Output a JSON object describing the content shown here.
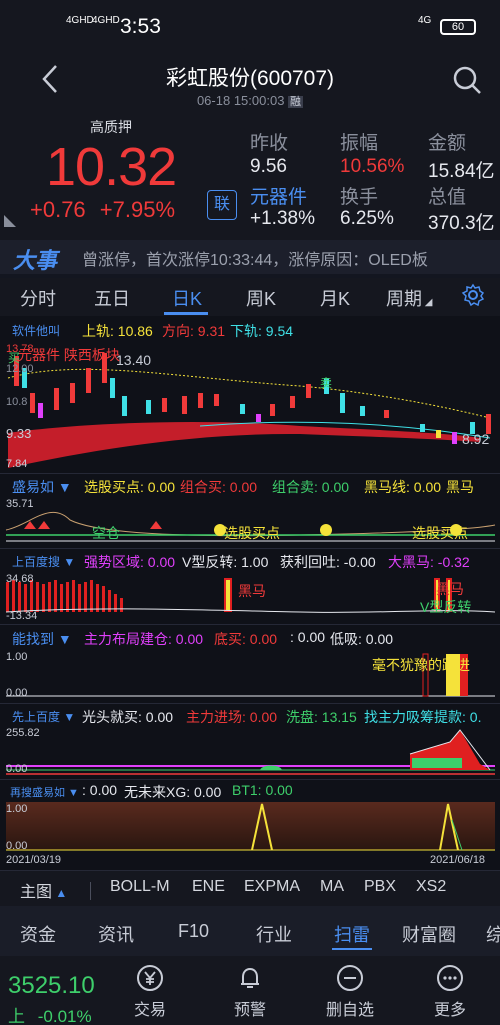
{
  "status_bar": {
    "time": "3:53",
    "net1": "4GHD",
    "net2": "4GHD",
    "net3": "4G",
    "battery": "60"
  },
  "header": {
    "title": "彩虹股份(600707)",
    "subtitle": "06-18 15:00:03",
    "subtitle_badge": "融"
  },
  "quote": {
    "pledge_label": "高质押",
    "price": "10.32",
    "change_abs": "+0.76",
    "change_pct": "+7.95%",
    "lian_label": "联",
    "stats": [
      {
        "label": "昨收",
        "value": "9.56"
      },
      {
        "label": "振幅",
        "value": "10.56%"
      },
      {
        "label": "金额",
        "value": "15.84亿"
      },
      {
        "label": "元器件",
        "value": "+1.38%"
      },
      {
        "label": "换手",
        "value": "6.25%"
      },
      {
        "label": "总值",
        "value": "370.3亿"
      }
    ]
  },
  "news": {
    "tag": "大事",
    "text": "曾涨停，首次涨停10:33:44，涨停原因：OLED板"
  },
  "tabs": [
    "分时",
    "五日",
    "日K",
    "周K",
    "月K",
    "周期"
  ],
  "panel1": {
    "name": "软件他叫",
    "upper": "上轨: 10.86",
    "dir": "方向: 9.31",
    "lower": "下轨: 9.54",
    "y_top": "13.78",
    "y_mid1": "12.00",
    "y_mid2": "10.8",
    "y_low": "9.33",
    "y_bottom": "7.84",
    "hi_label": "13.40",
    "lo_label": "8.92",
    "tags": "元器件 陕西板块",
    "marker1": "买",
    "marker2": "卖"
  },
  "panel2": {
    "name": "盛易如",
    "f1": "选股买点: 0.00",
    "f2": "组合买: 0.00",
    "f3": "组合卖: 0.00",
    "f4": "黑马线: 0.00",
    "f5": "黑马",
    "y_top": "35.71",
    "a1": "空仓",
    "a2": "选股买点",
    "a3": "选股买点"
  },
  "panel3": {
    "name": "上百度搜",
    "f1": "强势区域: 0.00",
    "f2": "V型反转: 1.00",
    "f3": "获利回吐: -0.00",
    "f4": "大黑马: -0.32",
    "y_top": "34.68",
    "y_bottom": "-13.34",
    "a1": "黑马",
    "a2": "黑马",
    "a3": "V型反转"
  },
  "panel4": {
    "name": "能找到",
    "f1": "主力布局建仓: 0.00",
    "f2": "底买: 0.00",
    "f3": ": 0.00",
    "f4": "低吸: 0.00",
    "y_top": "1.00",
    "y_bottom": "0.00",
    "a1": "毫不犹豫的跟进"
  },
  "panel5": {
    "name": "先上百度",
    "f1": "光头就买: 0.00",
    "f2": "主力进场: 0.00",
    "f3": "洗盘: 13.15",
    "f4": "找主力吸筹提款: 0.",
    "y_top": "255.82",
    "y_bottom": "0.00"
  },
  "panel6": {
    "name": "再搜盛易如",
    "f1": ": 0.00",
    "f2": "无未来XG: 0.00",
    "f3": "BT1: 0.00",
    "y_top": "1.00",
    "y_bottom": "0.00",
    "date_start": "2021/03/19",
    "date_end": "2021/06/18"
  },
  "indicators": [
    "主图",
    "BOLL-M",
    "ENE",
    "EXPMA",
    "MA",
    "PBX",
    "XS2"
  ],
  "nav_tabs": [
    "资金",
    "资讯",
    "F10",
    "行业",
    "扫雷",
    "财富圈",
    "综"
  ],
  "footer": {
    "index_value": "3525.10",
    "index_label": "上",
    "index_change": "-0.01%",
    "buttons": [
      "交易",
      "预警",
      "删自选",
      "更多"
    ]
  },
  "colors": {
    "up": "#f03a3a",
    "down": "#3ecf6b",
    "accent": "#4a8ef0",
    "cyan": "#3fe0e6",
    "yellow": "#f5e23a"
  }
}
